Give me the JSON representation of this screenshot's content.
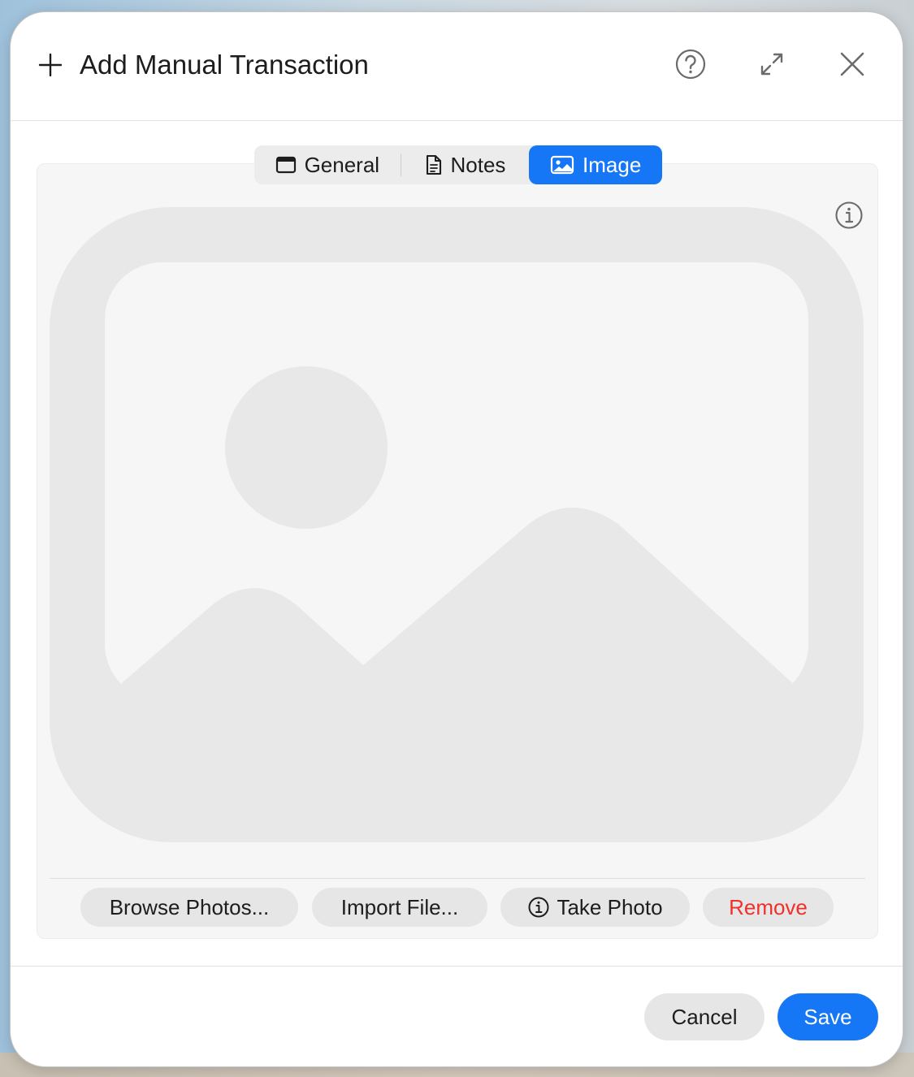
{
  "dialog": {
    "title": "Add Manual Transaction",
    "icons": {
      "title": "plus-icon",
      "help": "question-circle-icon",
      "expand": "expand-arrows-icon",
      "close": "close-icon"
    }
  },
  "tabs": [
    {
      "label": "General",
      "icon": "window-icon",
      "selected": false
    },
    {
      "label": "Notes",
      "icon": "document-icon",
      "selected": false
    },
    {
      "label": "Image",
      "icon": "photo-icon",
      "selected": true
    }
  ],
  "image_panel": {
    "info_icon": "info-circle-icon",
    "placeholder_icon": "image-placeholder-icon"
  },
  "actions": {
    "browse_label": "Browse Photos...",
    "import_label": "Import File...",
    "take_photo_label": "Take Photo",
    "take_photo_icon": "info-circle-icon",
    "remove_label": "Remove"
  },
  "footer": {
    "cancel_label": "Cancel",
    "save_label": "Save"
  },
  "colors": {
    "accent": "#1677f6",
    "destructive": "#f0302a",
    "panel_bg": "#f6f6f6",
    "button_bg": "#e6e6e6",
    "placeholder_fill": "#e8e8e8"
  }
}
